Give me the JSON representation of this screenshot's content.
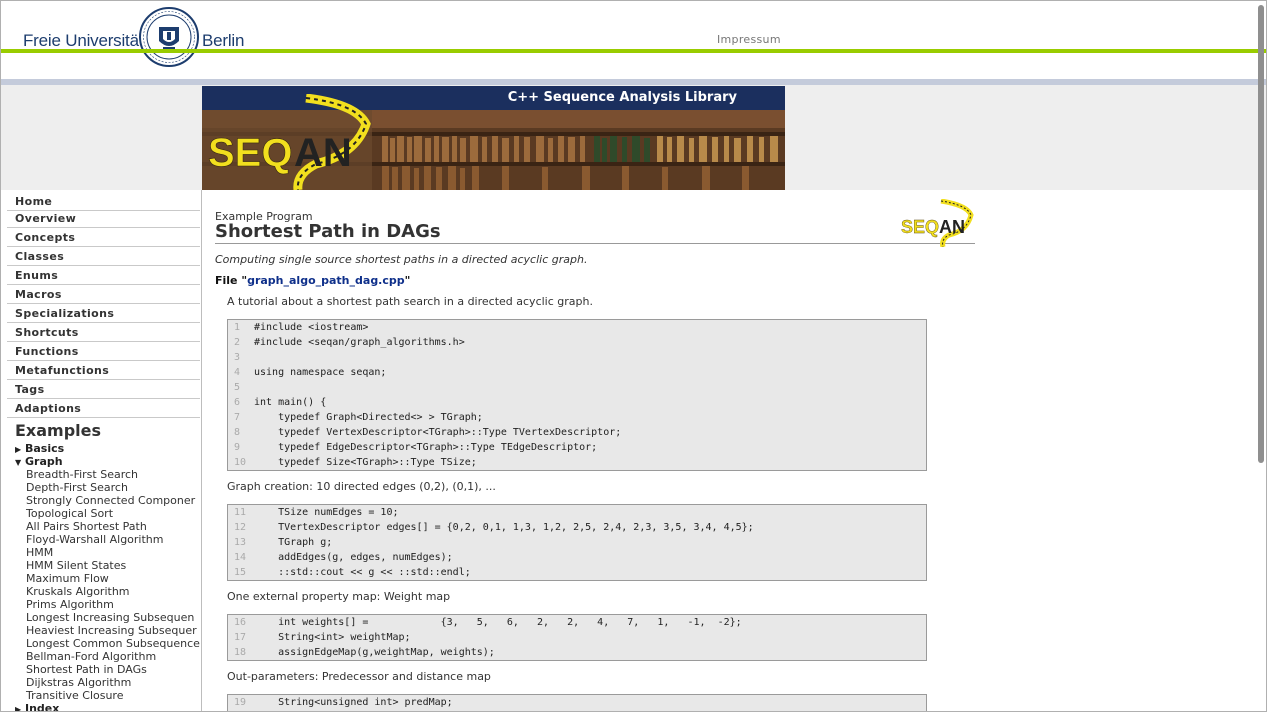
{
  "header": {
    "wordmark_left": "Freie Universität",
    "wordmark_right": "Berlin",
    "impressum": "Impressum"
  },
  "banner": {
    "title": "C++ Sequence Analysis Library",
    "logo_text": "SEQAN"
  },
  "sidebar": {
    "nav": [
      "Home",
      "Overview",
      "Concepts",
      "Classes",
      "Enums",
      "Macros",
      "Specializations",
      "Shortcuts",
      "Functions",
      "Metafunctions",
      "Tags",
      "Adaptions"
    ],
    "examples_heading": "Examples",
    "categories": [
      {
        "label": "Basics",
        "expanded": false
      },
      {
        "label": "Graph",
        "expanded": true
      }
    ],
    "graph_items": [
      "Breadth-First Search",
      "Depth-First Search",
      "Strongly Connected Componer",
      "Topological Sort",
      "All Pairs Shortest Path",
      "Floyd-Warshall Algorithm",
      "HMM",
      "HMM Silent States",
      "Maximum Flow",
      "Kruskals Algorithm",
      "Prims Algorithm",
      "Longest Increasing Subsequen",
      "Heaviest Increasing Subsequer",
      "Longest Common Subsequence",
      "Bellman-Ford Algorithm",
      "Shortest Path in DAGs",
      "Dijkstras Algorithm",
      "Transitive Closure"
    ],
    "index_category": "Index"
  },
  "main": {
    "kicker": "Example Program",
    "title": "Shortest Path in DAGs",
    "subtitle": "Computing single source shortest paths in a directed acyclic graph.",
    "file_prefix": "File \"",
    "file_name": "graph_algo_path_dag.cpp",
    "file_suffix": "\"",
    "intro": "A tutorial about a shortest path search in a directed acyclic graph.",
    "blocks": [
      {
        "lines": [
          {
            "n": "1",
            "code": "#include <iostream>"
          },
          {
            "n": "2",
            "code": "#include <seqan/graph_algorithms.h>"
          },
          {
            "n": "3",
            "code": ""
          },
          {
            "n": "4",
            "code": "using namespace seqan;"
          },
          {
            "n": "5",
            "code": ""
          },
          {
            "n": "6",
            "code": "int main() {"
          },
          {
            "n": "7",
            "code": "    typedef Graph<Directed<> > TGraph;"
          },
          {
            "n": "8",
            "code": "    typedef VertexDescriptor<TGraph>::Type TVertexDescriptor;"
          },
          {
            "n": "9",
            "code": "    typedef EdgeDescriptor<TGraph>::Type TEdgeDescriptor;"
          },
          {
            "n": "10",
            "code": "    typedef Size<TGraph>::Type TSize;"
          }
        ]
      },
      {
        "caption": "Graph creation: 10 directed edges (0,2), (0,1), ...",
        "lines": [
          {
            "n": "11",
            "code": "    TSize numEdges = 10;"
          },
          {
            "n": "12",
            "code": "    TVertexDescriptor edges[] = {0,2, 0,1, 1,3, 1,2, 2,5, 2,4, 2,3, 3,5, 3,4, 4,5};"
          },
          {
            "n": "13",
            "code": "    TGraph g;"
          },
          {
            "n": "14",
            "code": "    addEdges(g, edges, numEdges);"
          },
          {
            "n": "15",
            "code": "    ::std::cout << g << ::std::endl;"
          }
        ]
      },
      {
        "caption": "One external property map: Weight map",
        "lines": [
          {
            "n": "16",
            "code": "    int weights[] =            {3,   5,   6,   2,   2,   4,   7,   1,   -1,  -2};"
          },
          {
            "n": "17",
            "code": "    String<int> weightMap;"
          },
          {
            "n": "18",
            "code": "    assignEdgeMap(g,weightMap, weights);"
          }
        ]
      },
      {
        "caption": "Out-parameters: Predecessor and distance map",
        "lines": [
          {
            "n": "19",
            "code": "    String<unsigned int> predMap;"
          }
        ]
      }
    ]
  },
  "colors": {
    "fu_green": "#99cc00",
    "fu_blue": "#1d3d6e",
    "banner_navy": "#1b2f5e",
    "seqan_yellow": "#f2df1e",
    "link_blue": "#0e2f8a"
  }
}
